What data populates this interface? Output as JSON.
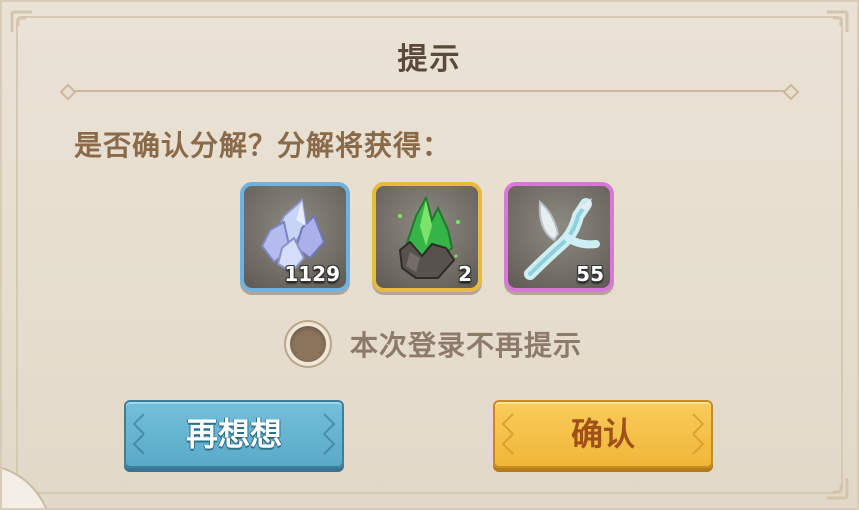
{
  "dialog": {
    "title": "提示",
    "message": "是否确认分解？分解将获得：",
    "items": [
      {
        "name": "crystal",
        "icon": "blue-crystal-icon",
        "rarity_color": "#6fb2e0",
        "count": "1129"
      },
      {
        "name": "green-ore",
        "icon": "green-crystal-ore-icon",
        "rarity_color": "#e8b93a",
        "count": "2"
      },
      {
        "name": "branch",
        "icon": "ice-branch-icon",
        "rarity_color": "#d778d8",
        "count": "55"
      }
    ],
    "dont_remind": {
      "label": "本次登录不再提示",
      "checked": false
    },
    "buttons": {
      "cancel_label": "再想想",
      "confirm_label": "确认"
    }
  }
}
